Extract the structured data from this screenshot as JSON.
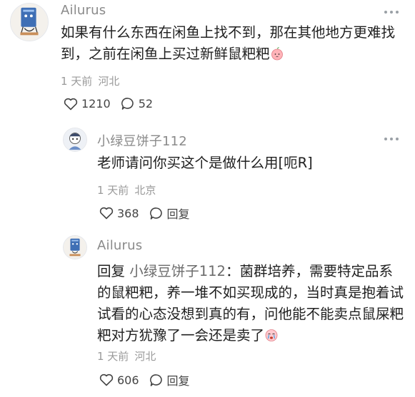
{
  "comments": [
    {
      "username": "Ailurus",
      "text": "如果有什么东西在闲鱼上找不到，那在其他地方更难找到，之前在闲鱼上买过新鲜鼠粑粑",
      "time": "1 天前",
      "location": "河北",
      "likes": "1210",
      "replies": "52",
      "emoji_icon": "peach-face-icon"
    },
    {
      "username": "小绿豆饼子112",
      "text": "老师请问你买这个是做什么用[呃R]",
      "time": "1 天前",
      "location": "北京",
      "likes": "368",
      "reply_label": "回复"
    },
    {
      "username": "Ailurus",
      "reply_prefix": "回复",
      "reply_target": "小绿豆饼子112",
      "text": "：菌群培养，需要特定品系的鼠粑粑，养一堆不如买现成的，当时真是抱着试试看的心态没想到真的有，问他能不能卖点鼠屎粑粑对方犹豫了一会还是卖了",
      "time": "1 天前",
      "location": "河北",
      "likes": "606",
      "reply_label": "回复",
      "emoji_icon": "crying-face-icon"
    }
  ],
  "colors": {
    "username": "#8a8a8a",
    "meta": "#9a9a9a",
    "text": "#202020"
  }
}
